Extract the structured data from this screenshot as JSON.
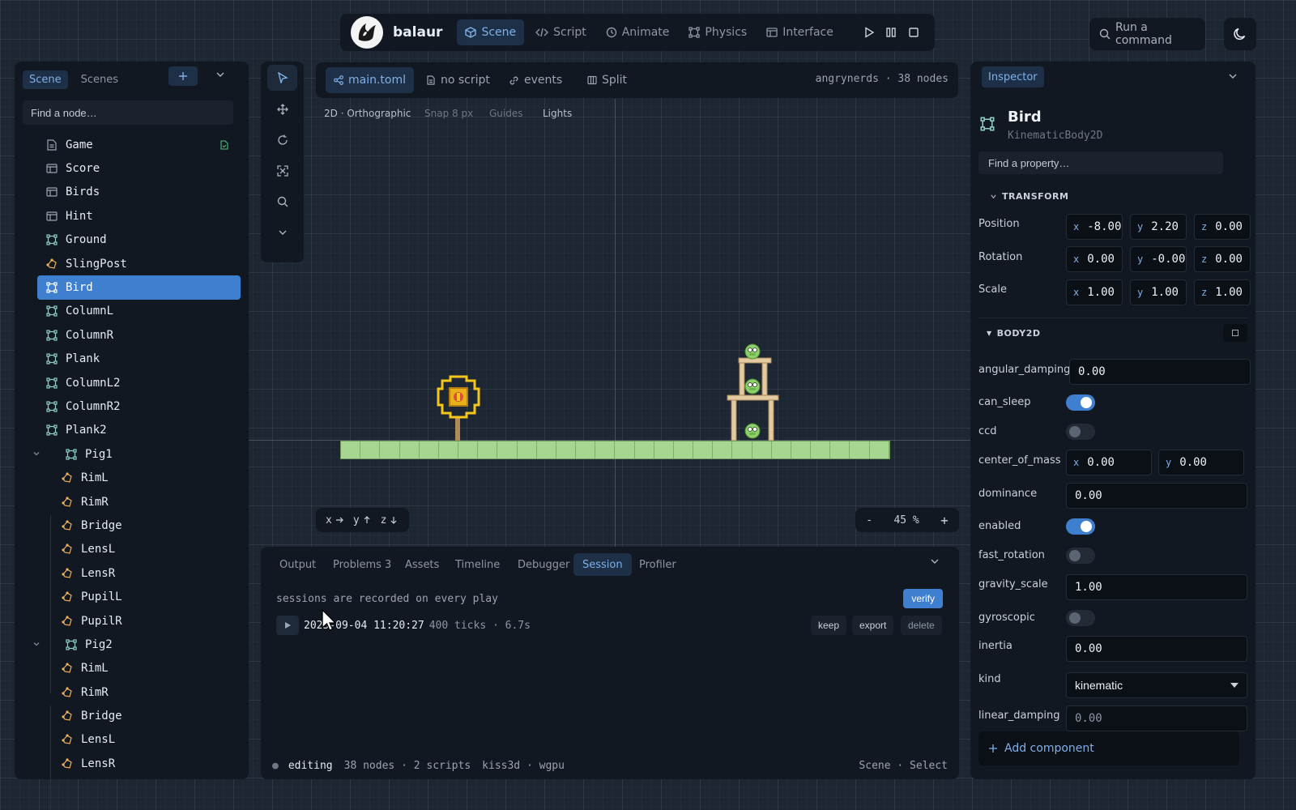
{
  "app": {
    "brand": "balaur",
    "nav": [
      {
        "label": "Scene",
        "icon": "cube-icon",
        "active": true
      },
      {
        "label": "Script",
        "icon": "code-icon",
        "active": false
      },
      {
        "label": "Animate",
        "icon": "clock-icon",
        "active": false
      },
      {
        "label": "Physics",
        "icon": "physics-icon",
        "active": false
      },
      {
        "label": "Interface",
        "icon": "layout-icon",
        "active": false
      }
    ],
    "command_label": "Run a command"
  },
  "left_panel": {
    "tabs": [
      {
        "label": "Scene",
        "active": true
      },
      {
        "label": "Scenes",
        "active": false
      }
    ],
    "search_placeholder": "Find a node…",
    "nodes": [
      {
        "label": "Game",
        "icon": "scene-icon",
        "depth": 0,
        "badge": true
      },
      {
        "label": "Score",
        "icon": "ui-icon",
        "depth": 0
      },
      {
        "label": "Birds",
        "icon": "ui-icon",
        "depth": 0
      },
      {
        "label": "Hint",
        "icon": "ui-icon",
        "depth": 0
      },
      {
        "label": "Ground",
        "icon": "body-icon",
        "depth": 0
      },
      {
        "label": "SlingPost",
        "icon": "shape-icon",
        "depth": 0
      },
      {
        "label": "Bird",
        "icon": "body-icon",
        "depth": 0,
        "selected": true
      },
      {
        "label": "ColumnL",
        "icon": "body-icon",
        "depth": 0
      },
      {
        "label": "ColumnR",
        "icon": "body-icon",
        "depth": 0
      },
      {
        "label": "Plank",
        "icon": "body-icon",
        "depth": 0
      },
      {
        "label": "ColumnL2",
        "icon": "body-icon",
        "depth": 0
      },
      {
        "label": "ColumnR2",
        "icon": "body-icon",
        "depth": 0
      },
      {
        "label": "Plank2",
        "icon": "body-icon",
        "depth": 0
      },
      {
        "label": "Pig1",
        "icon": "body-icon",
        "depth": 1,
        "expanded": true
      },
      {
        "label": "RimL",
        "icon": "shape-icon",
        "depth": 2
      },
      {
        "label": "RimR",
        "icon": "shape-icon",
        "depth": 2
      },
      {
        "label": "Bridge",
        "icon": "shape-icon",
        "depth": 2
      },
      {
        "label": "LensL",
        "icon": "shape-icon",
        "depth": 2
      },
      {
        "label": "LensR",
        "icon": "shape-icon",
        "depth": 2
      },
      {
        "label": "PupilL",
        "icon": "shape-icon",
        "depth": 2
      },
      {
        "label": "PupilR",
        "icon": "shape-icon",
        "depth": 2
      },
      {
        "label": "Pig2",
        "icon": "body-icon",
        "depth": 1,
        "expanded": true
      },
      {
        "label": "RimL",
        "icon": "shape-icon",
        "depth": 2
      },
      {
        "label": "RimR",
        "icon": "shape-icon",
        "depth": 2
      },
      {
        "label": "Bridge",
        "icon": "shape-icon",
        "depth": 2
      },
      {
        "label": "LensL",
        "icon": "shape-icon",
        "depth": 2
      },
      {
        "label": "LensR",
        "icon": "shape-icon",
        "depth": 2
      }
    ]
  },
  "viewport": {
    "tabs": [
      {
        "label": "main.toml",
        "icon": "graph-icon",
        "active": true
      },
      {
        "label": "no script",
        "icon": "file-icon",
        "active": false
      },
      {
        "label": "events",
        "icon": "link-icon",
        "active": false
      },
      {
        "label": "Split",
        "icon": "split-icon",
        "active": false
      }
    ],
    "scene_info": "angrynerds · 38 nodes",
    "options": [
      {
        "label": "2D · Orthographic",
        "on": true
      },
      {
        "label": "Snap 8 px",
        "on": false
      },
      {
        "label": "Guides",
        "on": false
      },
      {
        "label": "Lights",
        "on": true
      }
    ],
    "axes": {
      "x": "x",
      "y": "y",
      "z": "z"
    },
    "zoom": {
      "minus": "-",
      "value": "45 %",
      "plus": "+"
    }
  },
  "bottom_panel": {
    "tabs": [
      {
        "label": "Output",
        "active": false
      },
      {
        "label": "Problems 3",
        "active": false
      },
      {
        "label": "Assets",
        "active": false
      },
      {
        "label": "Timeline",
        "active": false
      },
      {
        "label": "Debugger",
        "active": false
      },
      {
        "label": "Session",
        "active": true
      },
      {
        "label": "Profiler",
        "active": false
      }
    ],
    "note": "sessions are recorded on every play",
    "verify_label": "verify",
    "session": {
      "timestamp": "2025-09-04 11:20:27",
      "ticks": "400 ticks · 6.7s"
    },
    "actions": {
      "keep": "keep",
      "export": "export",
      "delete": "delete"
    },
    "status": {
      "state": "editing",
      "counts": "38 nodes · 2 scripts",
      "backend": "kiss3d · wgpu",
      "mode": "Scene · Select"
    }
  },
  "inspector": {
    "tab_label": "Inspector",
    "object_name": "Bird",
    "object_type": "KinematicBody2D",
    "search_placeholder": "Find a property…",
    "transform_title": "TRANSFORM",
    "transform": [
      {
        "label": "Position",
        "x": "-8.00",
        "y": "2.20",
        "z": "0.00"
      },
      {
        "label": "Rotation",
        "x": "0.00",
        "y": "-0.00",
        "z": "0.00"
      },
      {
        "label": "Scale",
        "x": "1.00",
        "y": "1.00",
        "z": "1.00"
      }
    ],
    "body_title": "BODY2D",
    "properties": {
      "angular_damping": {
        "label": "angular_damping",
        "value": "0.00"
      },
      "can_sleep": {
        "label": "can_sleep",
        "on": true
      },
      "ccd": {
        "label": "ccd",
        "on": false
      },
      "center_of_mass": {
        "label": "center_of_mass",
        "x": "0.00",
        "y": "0.00"
      },
      "dominance": {
        "label": "dominance",
        "value": "0.00"
      },
      "enabled": {
        "label": "enabled",
        "on": true
      },
      "fast_rotation": {
        "label": "fast_rotation",
        "on": false
      },
      "gravity_scale": {
        "label": "gravity_scale",
        "value": "1.00"
      },
      "gyroscopic": {
        "label": "gyroscopic",
        "on": false
      },
      "inertia": {
        "label": "inertia",
        "value": "0.00"
      },
      "kind": {
        "label": "kind",
        "value": "kinematic"
      },
      "linear_damping": {
        "label": "linear_damping",
        "value": "0.00"
      }
    },
    "add_component_label": "Add component"
  },
  "colors": {
    "accent": "#3f7fcf",
    "accent_soft": "#7fb0e8",
    "panel": "#121821",
    "ground": "#a6d68f",
    "sling": "#f5c518",
    "pig": "#8dd16b"
  }
}
